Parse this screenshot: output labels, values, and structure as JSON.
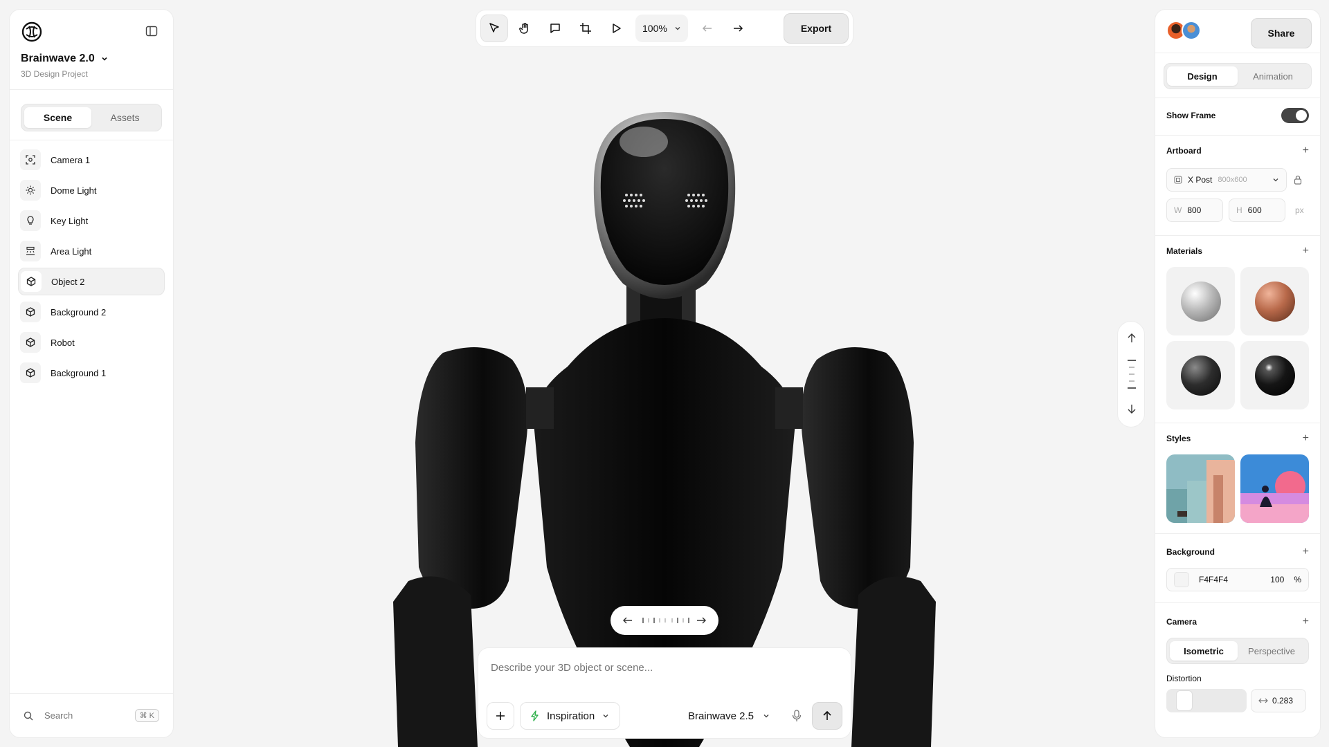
{
  "project": {
    "title": "Brainwave 2.0",
    "subtitle": "3D Design Project"
  },
  "left_tabs": [
    "Scene",
    "Assets"
  ],
  "layers": [
    {
      "label": "Camera 1",
      "icon": "camera-focus-icon"
    },
    {
      "label": "Dome Light",
      "icon": "sun-icon"
    },
    {
      "label": "Key Light",
      "icon": "bulb-icon"
    },
    {
      "label": "Area Light",
      "icon": "area-light-icon"
    },
    {
      "label": "Object 2",
      "icon": "cube-icon",
      "selected": true
    },
    {
      "label": "Background 2",
      "icon": "cube-icon"
    },
    {
      "label": "Robot",
      "icon": "cube-icon"
    },
    {
      "label": "Background 1",
      "icon": "cube-icon"
    }
  ],
  "search": {
    "label": "Search",
    "shortcut": "⌘ K"
  },
  "toolbar": {
    "zoom": "100%",
    "export_label": "Export"
  },
  "right": {
    "share_label": "Share",
    "tabs": [
      "Design",
      "Animation"
    ],
    "show_frame_label": "Show Frame",
    "show_frame": true,
    "artboard": {
      "title": "Artboard",
      "preset": "X Post",
      "preset_size": "800x600",
      "w_label": "W",
      "w": "800",
      "h_label": "H",
      "h": "600",
      "unit": "px"
    },
    "materials_title": "Materials",
    "styles_title": "Styles",
    "background": {
      "title": "Background",
      "hex": "F4F4F4",
      "opacity": "100",
      "unit": "%"
    },
    "camera": {
      "title": "Camera",
      "modes": [
        "Isometric",
        "Perspective"
      ],
      "distortion_label": "Distortion",
      "distortion_value": "0.283"
    }
  },
  "prompt": {
    "placeholder": "Describe your 3D object or scene...",
    "inspiration": "Inspiration",
    "model": "Brainwave 2.5"
  },
  "colors": {
    "canvas": "#f4f4f4",
    "accent": "#111111"
  }
}
